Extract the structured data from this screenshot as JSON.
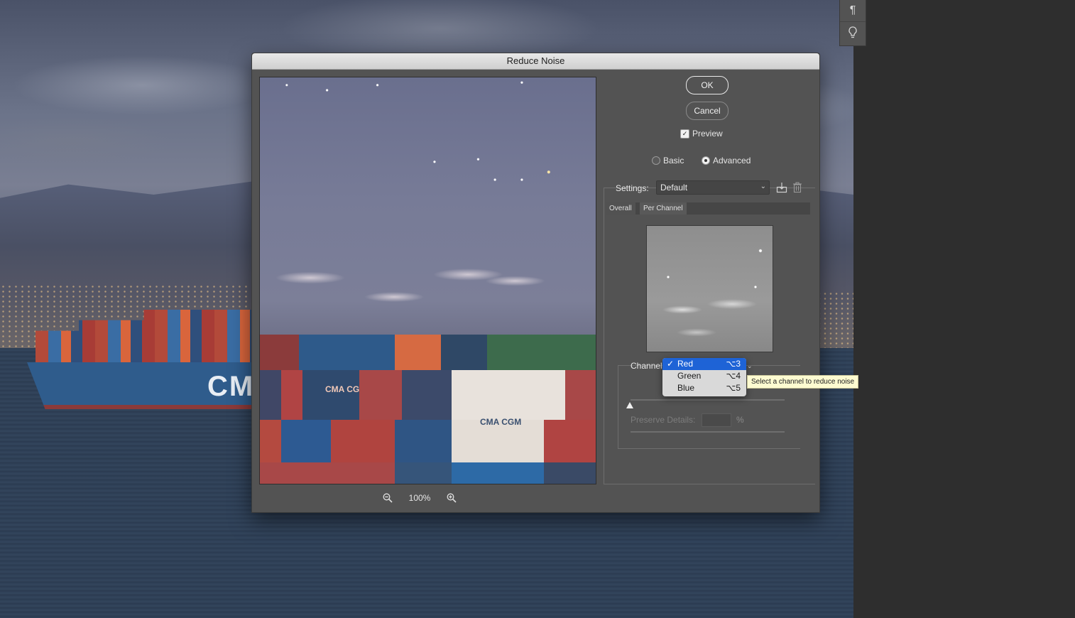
{
  "dialog": {
    "title": "Reduce Noise",
    "ok_label": "OK",
    "cancel_label": "Cancel",
    "preview_label": "Preview",
    "preview_checked": true,
    "mode": {
      "basic_label": "Basic",
      "advanced_label": "Advanced",
      "selected": "Advanced"
    },
    "settings": {
      "label": "Settings:",
      "value": "Default"
    },
    "tabs": [
      {
        "label": "Overall"
      },
      {
        "label": "Per Channel"
      }
    ],
    "channel": {
      "label": "Channel",
      "options": [
        {
          "label": "Red",
          "shortcut": "⌥3",
          "selected": true
        },
        {
          "label": "Green",
          "shortcut": "⌥4",
          "selected": false
        },
        {
          "label": "Blue",
          "shortcut": "⌥5",
          "selected": false
        }
      ],
      "tooltip": "Select a channel to reduce noise"
    },
    "preserve_details_label": "Preserve Details:",
    "preserve_details_unit": "%",
    "zoom": "100%"
  },
  "canvas": {
    "ship_text": "CMA"
  },
  "preview": {
    "label_left": "CMA CG",
    "label_right": "CMA CGM"
  },
  "colors": {
    "dialog_bg": "#535353",
    "menu_selected": "#1e63d6",
    "tooltip_bg": "#fdfbd1"
  }
}
